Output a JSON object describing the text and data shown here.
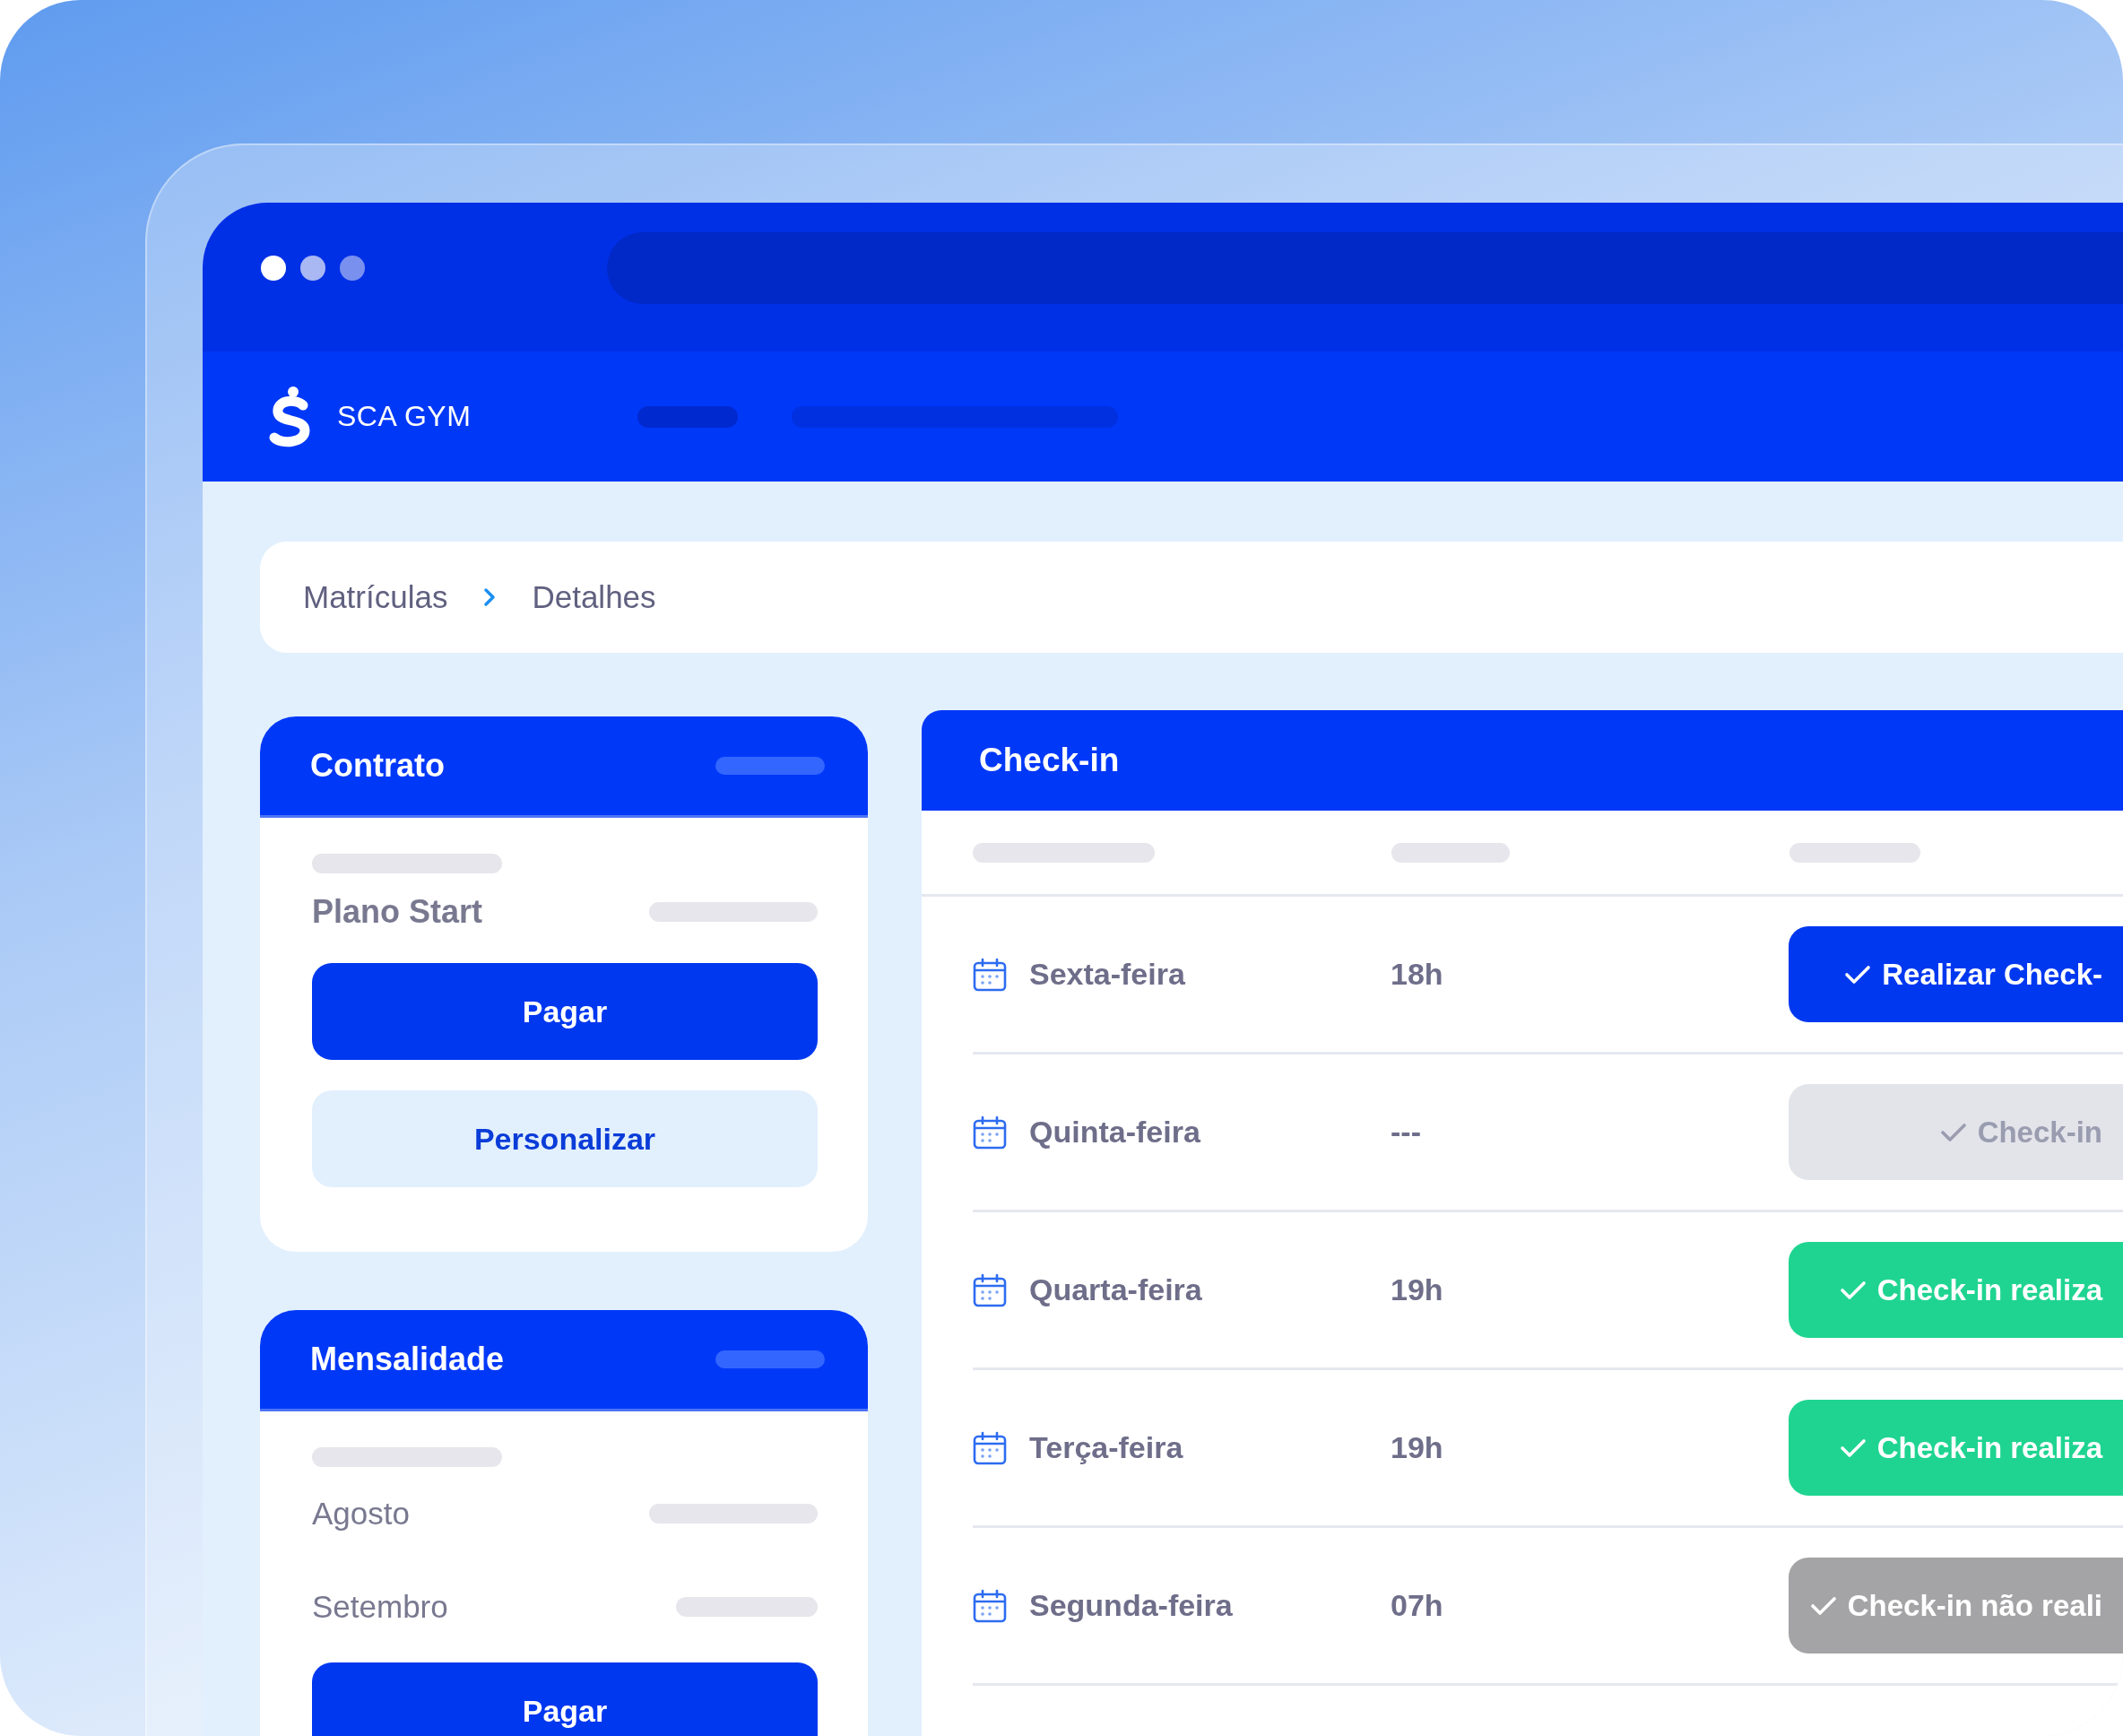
{
  "nav": {
    "brand": "SCA GYM"
  },
  "breadcrumb": [
    {
      "label": "Matrículas"
    },
    {
      "label": "Detalhes"
    }
  ],
  "contract": {
    "title": "Contrato",
    "plan": "Plano Start",
    "buttons": [
      {
        "label": "Pagar",
        "kind": "primary"
      },
      {
        "label": "Personalizar",
        "kind": "secondary"
      }
    ]
  },
  "monthly": {
    "title": "Mensalidade",
    "months": [
      "Agosto",
      "Setembro"
    ],
    "button": "Pagar"
  },
  "checkin": {
    "title": "Check-in",
    "rows": [
      {
        "day": "Sexta-feira",
        "time": "18h",
        "action": "Realizar Check-",
        "kind": "available"
      },
      {
        "day": "Quinta-feira",
        "time": "---",
        "action": "Check-in",
        "kind": "disabled"
      },
      {
        "day": "Quarta-feira",
        "time": "19h",
        "action": "Check-in realiza",
        "kind": "done"
      },
      {
        "day": "Terça-feira",
        "time": "19h",
        "action": "Check-in realiza",
        "kind": "done"
      },
      {
        "day": "Segunda-feira",
        "time": "07h",
        "action": "Check-in não reali",
        "kind": "missed"
      }
    ]
  }
}
